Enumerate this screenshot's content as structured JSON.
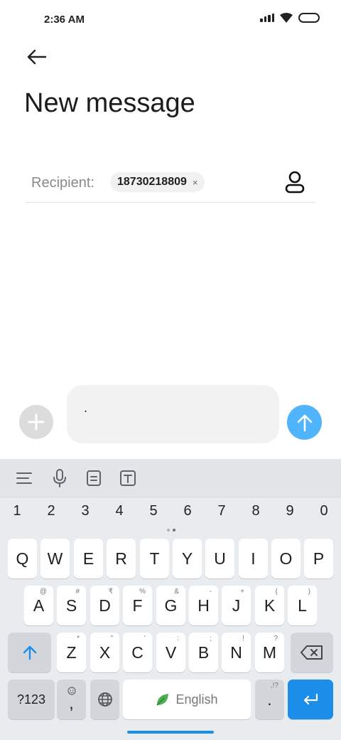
{
  "status_bar": {
    "time": "2:36 AM"
  },
  "header": {
    "title": "New message"
  },
  "recipient": {
    "label": "Recipient:",
    "number": "18730218809",
    "remove_symbol": "×"
  },
  "composer": {
    "text": "."
  },
  "keyboard": {
    "number_row": [
      "1",
      "2",
      "3",
      "4",
      "5",
      "6",
      "7",
      "8",
      "9",
      "0"
    ],
    "row1": [
      "Q",
      "W",
      "E",
      "R",
      "T",
      "Y",
      "U",
      "I",
      "O",
      "P"
    ],
    "row2": [
      {
        "label": "A",
        "hint": "@"
      },
      {
        "label": "S",
        "hint": "#"
      },
      {
        "label": "D",
        "hint": "₹"
      },
      {
        "label": "F",
        "hint": "%"
      },
      {
        "label": "G",
        "hint": "&"
      },
      {
        "label": "H",
        "hint": "-"
      },
      {
        "label": "J",
        "hint": "+"
      },
      {
        "label": "K",
        "hint": "("
      },
      {
        "label": "L",
        "hint": ")"
      }
    ],
    "row3": [
      {
        "label": "Z",
        "hint": "*"
      },
      {
        "label": "X",
        "hint": "\""
      },
      {
        "label": "C",
        "hint": "'"
      },
      {
        "label": "V",
        "hint": ":"
      },
      {
        "label": "B",
        "hint": ";"
      },
      {
        "label": "N",
        "hint": "!"
      },
      {
        "label": "M",
        "hint": "?"
      }
    ],
    "symbols_label": "?123",
    "comma_label": ",",
    "space_label": "English",
    "period_label": ".",
    "period_hint": ",!?"
  },
  "colors": {
    "accent": "#1a8ee8",
    "send": "#4fb4f9"
  },
  "icons": [
    "back-arrow-icon",
    "contact-icon",
    "plus-icon",
    "send-arrow-icon",
    "menu-icon",
    "microphone-icon",
    "clipboard-icon",
    "text-icon",
    "shift-icon",
    "backspace-icon",
    "emoji-icon",
    "globe-icon",
    "leaf-icon",
    "enter-icon"
  ]
}
